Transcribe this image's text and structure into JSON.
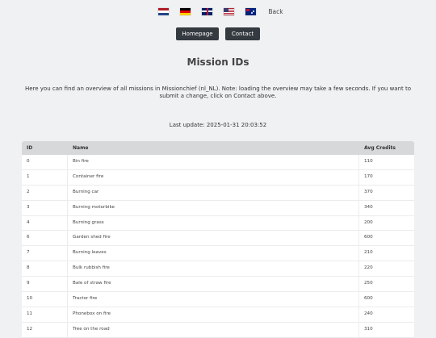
{
  "langbar": {
    "flags": [
      "netherlands-flag",
      "germany-flag",
      "uk-flag",
      "usa-flag",
      "australia-flag"
    ],
    "back_label": "Back"
  },
  "nav": {
    "homepage_label": "Homepage",
    "contact_label": "Contact"
  },
  "page": {
    "title": "Mission IDs",
    "intro": "Here you can find an overview of all missions in Missionchief (nl_NL). Note: loading the overview may take a few seconds. If you want to submit a change, click on Contact above.",
    "last_update": "Last update: 2025-01-31 20:03:52"
  },
  "table": {
    "headers": {
      "id": "ID",
      "name": "Name",
      "credits": "Avg Credits"
    },
    "rows": [
      {
        "id": "0",
        "name": "Bin fire",
        "credits": "110"
      },
      {
        "id": "1",
        "name": "Container fire",
        "credits": "170"
      },
      {
        "id": "2",
        "name": "Burning car",
        "credits": "370"
      },
      {
        "id": "3",
        "name": "Burning motorbike",
        "credits": "340"
      },
      {
        "id": "4",
        "name": "Burning grass",
        "credits": "200"
      },
      {
        "id": "6",
        "name": "Garden shed fire",
        "credits": "600"
      },
      {
        "id": "7",
        "name": "Burning leaves",
        "credits": "210"
      },
      {
        "id": "8",
        "name": "Bulk rubbish fire",
        "credits": "220"
      },
      {
        "id": "9",
        "name": "Bale of straw fire",
        "credits": "250"
      },
      {
        "id": "10",
        "name": "Tractor fire",
        "credits": "600"
      },
      {
        "id": "11",
        "name": "Phonebox on fire",
        "credits": "240"
      },
      {
        "id": "12",
        "name": "Tree on the road",
        "credits": "310"
      }
    ]
  }
}
